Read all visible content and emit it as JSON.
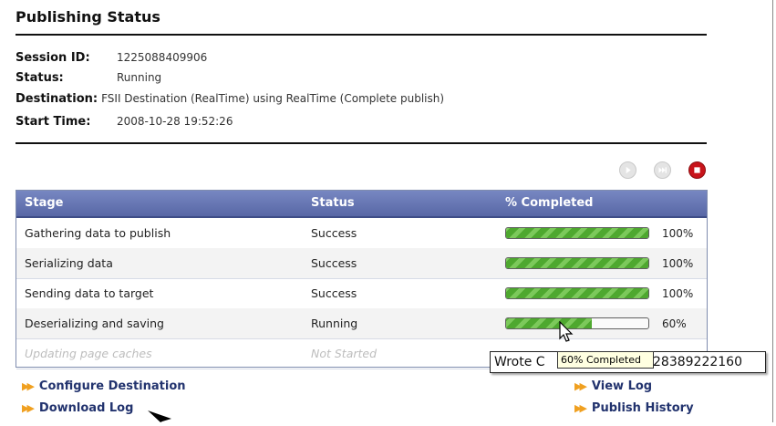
{
  "page": {
    "title": "Publishing Status"
  },
  "session": {
    "id_label": "Session ID:",
    "id_value": "1225088409906",
    "status_label": "Status:",
    "status_value": "Running",
    "destination_label": "Destination:",
    "destination_value": "FSII Destination (RealTime) using RealTime (Complete publish)",
    "start_label": "Start Time:",
    "start_value": "2008-10-28 19:52:26"
  },
  "controls": {
    "play_icon": "play-icon",
    "skip_icon": "skip-icon",
    "stop_icon": "stop-icon",
    "stop_color": "#c8141b"
  },
  "table": {
    "headers": {
      "stage": "Stage",
      "status": "Status",
      "completed": "% Completed"
    },
    "header_color": "#5f6eab",
    "rows": [
      {
        "stage": "Gathering data to publish",
        "status": "Success",
        "percent_label": "100%",
        "progress": 1.0
      },
      {
        "stage": "Serializing data",
        "status": "Success",
        "percent_label": "100%",
        "progress": 1.0
      },
      {
        "stage": "Sending data to target",
        "status": "Success",
        "percent_label": "100%",
        "progress": 1.0
      },
      {
        "stage": "Deserializing and saving",
        "status": "Running",
        "percent_label": "60%",
        "progress": 0.6
      },
      {
        "stage": "Updating page caches",
        "status": "Not Started",
        "percent_label": "",
        "progress": 0
      }
    ]
  },
  "tooltips": {
    "white_prefix": "Wrote C",
    "white_suffix": "28389222160",
    "yellow": "60% Completed"
  },
  "links": {
    "configure": "Configure Destination",
    "download": "Download Log",
    "view_log": "View Log",
    "history": "Publish History"
  }
}
